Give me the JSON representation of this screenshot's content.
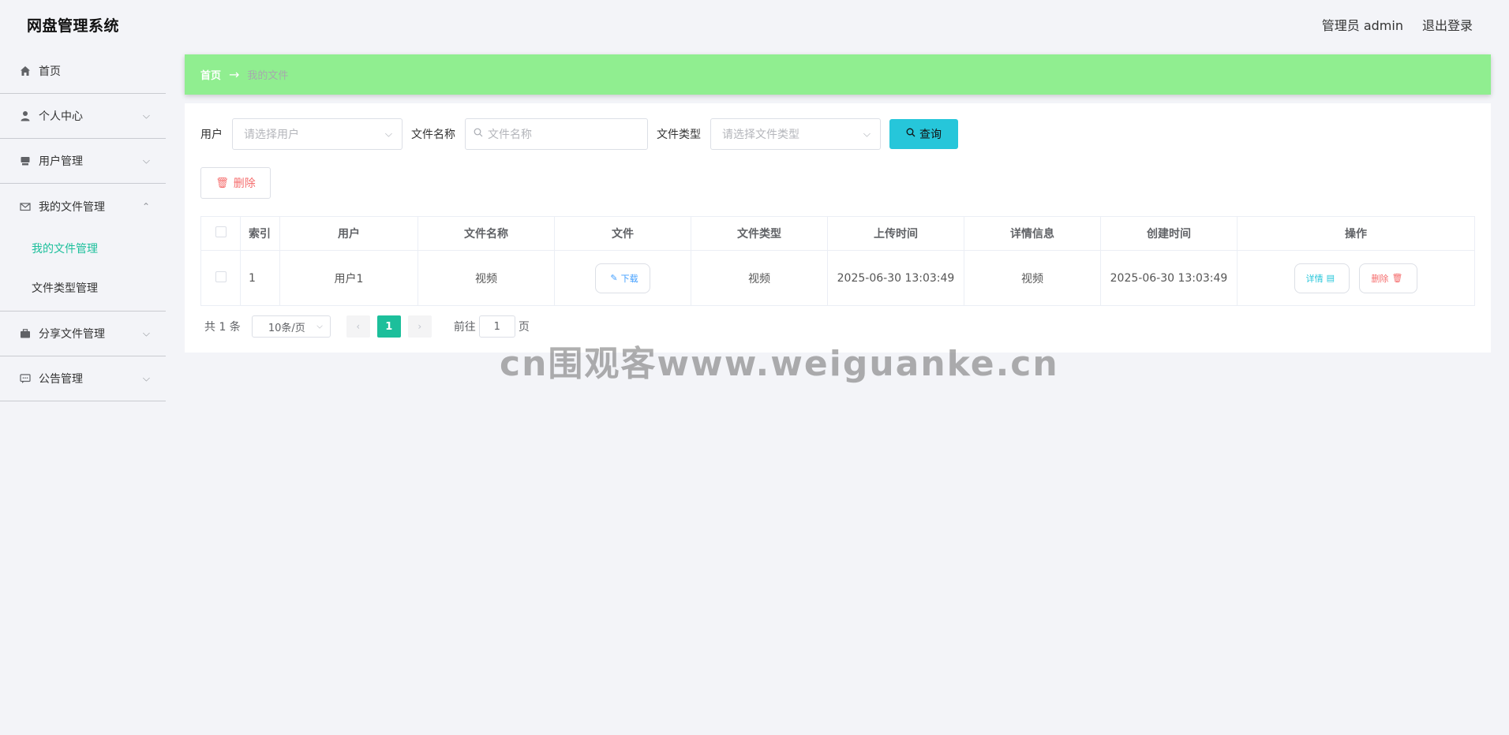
{
  "header": {
    "app_title": "网盘管理系统",
    "user_label": "管理员 admin",
    "logout_label": "退出登录"
  },
  "sidebar": {
    "items": [
      {
        "label": "首页",
        "icon": "home-icon"
      },
      {
        "label": "个人中心",
        "icon": "user-icon"
      },
      {
        "label": "用户管理",
        "icon": "users-icon"
      },
      {
        "label": "我的文件管理",
        "icon": "mail-icon"
      },
      {
        "label": "分享文件管理",
        "icon": "briefcase-icon"
      },
      {
        "label": "公告管理",
        "icon": "chat-icon"
      }
    ],
    "submenu": [
      {
        "label": "我的文件管理",
        "active": true
      },
      {
        "label": "文件类型管理",
        "active": false
      }
    ]
  },
  "breadcrumb": {
    "home": "首页",
    "separator": "→",
    "current": "我的文件"
  },
  "search": {
    "user_label": "用户",
    "user_placeholder": "请选择用户",
    "filename_label": "文件名称",
    "filename_placeholder": "文件名称",
    "filetype_label": "文件类型",
    "filetype_placeholder": "请选择文件类型",
    "query_button": "查询"
  },
  "actions": {
    "delete_button": "删除"
  },
  "table": {
    "columns": [
      "索引",
      "用户",
      "文件名称",
      "文件",
      "文件类型",
      "上传时间",
      "详情信息",
      "创建时间",
      "操作"
    ],
    "rows": [
      {
        "index": "1",
        "user": "用户1",
        "filename": "视频",
        "file_button": "下载",
        "filetype": "视频",
        "upload_time": "2025-06-30 13:03:49",
        "detail_info": "视频",
        "create_time": "2025-06-30 13:03:49",
        "detail_button": "详情",
        "delete_button": "删除"
      }
    ]
  },
  "pagination": {
    "total_text": "共 1 条",
    "page_size": "10条/页",
    "current_page": "1",
    "goto_label": "前往",
    "goto_value": "1",
    "page_unit": "页"
  },
  "watermark": "cn围观客www.weiguanke.cn",
  "colors": {
    "accent": "#1cbf9b",
    "breadcrumb_bg": "#90ee90",
    "query_button": "#26c6da",
    "danger": "#f56c6c"
  }
}
